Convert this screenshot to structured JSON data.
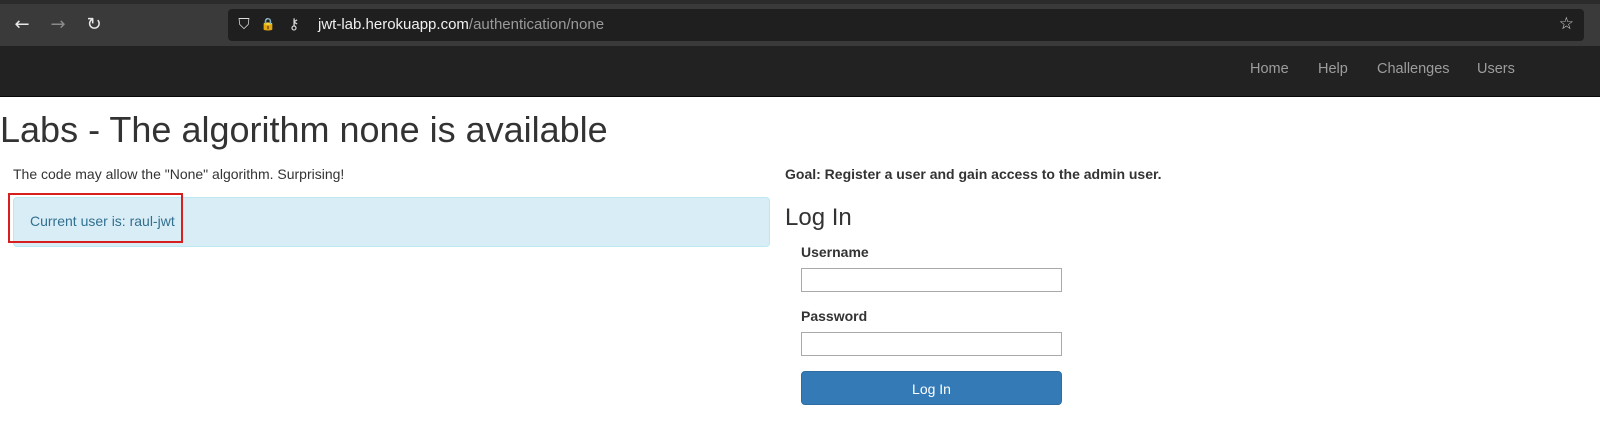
{
  "browser": {
    "back_icon": "←",
    "forward_icon": "→",
    "reload_icon": "↻",
    "shield_icon": "⛉",
    "lock_icon": "🔒",
    "key_icon": "⚷",
    "star_icon": "☆",
    "url_host": "jwt-lab.herokuapp.com",
    "url_path": "/authentication/none"
  },
  "navbar": {
    "items": [
      {
        "label": "Home"
      },
      {
        "label": "Help"
      },
      {
        "label": "Challenges"
      },
      {
        "label": "Users"
      }
    ]
  },
  "main": {
    "title": "Labs - The algorithm none is available",
    "intro": "The code may allow the \"None\" algorithm. Surprising!",
    "alert": "Current user is: raul-jwt"
  },
  "login": {
    "goal": "Goal: Register a user and gain access to the admin user.",
    "heading": "Log In",
    "username_label": "Username",
    "username_value": "",
    "password_label": "Password",
    "password_value": "",
    "submit_label": "Log In"
  },
  "colors": {
    "accent": "#337ab7",
    "alert_bg": "#d9edf7",
    "alert_text": "#31708f",
    "highlight": "#d81f1f",
    "navbar_bg": "#222222"
  }
}
